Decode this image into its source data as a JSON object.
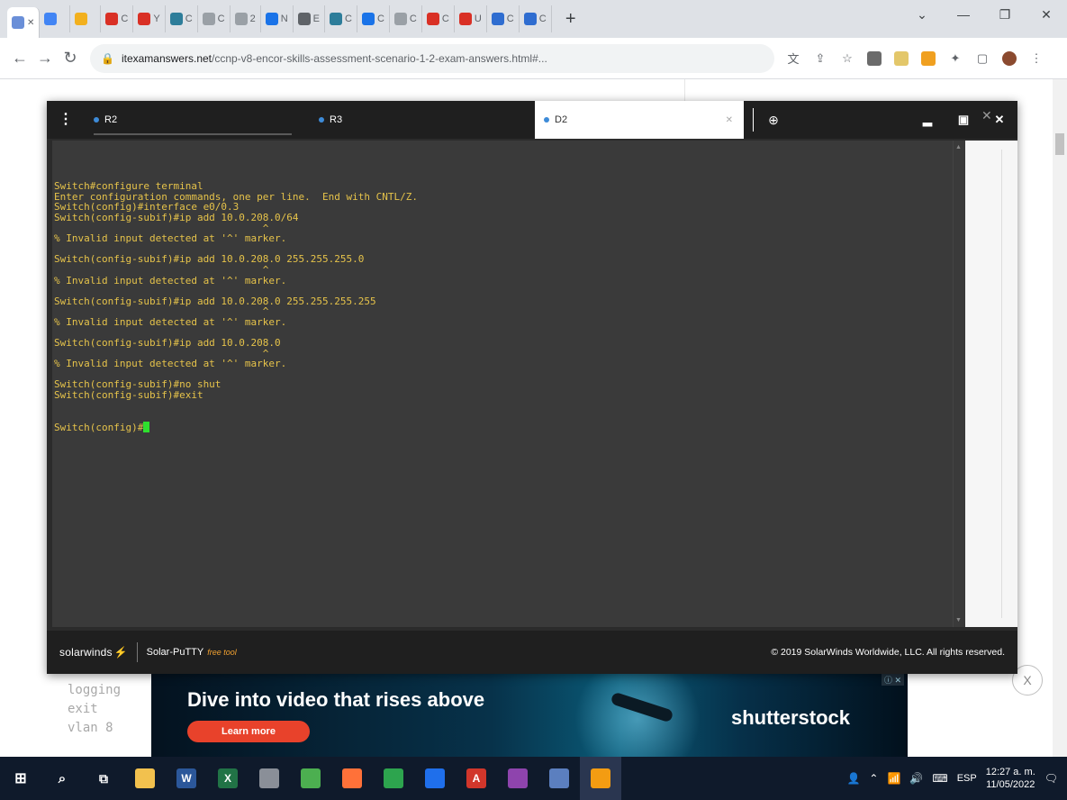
{
  "browser": {
    "tabs": [
      {
        "label": "",
        "color": "#4285f4"
      },
      {
        "label": "",
        "color": "#f2b01e"
      },
      {
        "label": "C",
        "color": "#d93025"
      },
      {
        "label": "Y",
        "color": "#d93025"
      },
      {
        "label": "C",
        "color": "#2d7d9a"
      },
      {
        "label": "C",
        "color": "#9aa0a6"
      },
      {
        "label": "2",
        "color": "#9aa0a6"
      },
      {
        "label": "N",
        "color": "#1a73e8"
      },
      {
        "label": "E",
        "color": "#5f6368"
      },
      {
        "label": "C",
        "color": "#2d7d9a"
      },
      {
        "label": "C",
        "color": "#1a73e8"
      },
      {
        "label": "C",
        "color": "#9aa0a6"
      },
      {
        "label": "C",
        "color": "#d93025"
      },
      {
        "label": "U",
        "color": "#d93025"
      },
      {
        "label": "C",
        "color": "#2f6dd0"
      },
      {
        "label": "C",
        "color": "#2f6dd0"
      }
    ],
    "url_host": "itexamanswers.net",
    "url_path": "/ccnp-v8-encor-skills-assessment-scenario-1-2-exam-answers.html#..."
  },
  "putty": {
    "tabs": [
      {
        "label": "R2"
      },
      {
        "label": "R3"
      },
      {
        "label": "D2"
      }
    ],
    "terminal_lines": [
      "Switch#configure terminal",
      "Enter configuration commands, one per line.  End with CNTL/Z.",
      "Switch(config)#interface e0/0.3",
      "Switch(config-subif)#ip add 10.0.208.0/64",
      "                                   ^",
      "% Invalid input detected at '^' marker.",
      "",
      "Switch(config-subif)#ip add 10.0.208.0 255.255.255.0",
      "                                   ^",
      "% Invalid input detected at '^' marker.",
      "",
      "Switch(config-subif)#ip add 10.0.208.0 255.255.255.255",
      "                                   ^",
      "% Invalid input detected at '^' marker.",
      "",
      "Switch(config-subif)#ip add 10.0.208.0",
      "                                   ^",
      "% Invalid input detected at '^' marker.",
      "",
      "Switch(config-subif)#no shut",
      "Switch(config-subif)#exit"
    ],
    "prompt": "Switch(config)#",
    "footer": {
      "brand": "solarwinds",
      "product": "Solar-PuTTY",
      "free_tag": "free tool",
      "copyright": "© 2019 SolarWinds Worldwide, LLC. All rights reserved."
    }
  },
  "page": {
    "code_lines": [
      "logging",
      "exit",
      "vlan 8"
    ]
  },
  "ad": {
    "headline": "Dive into video that rises above",
    "cta": "Learn more",
    "brand": "shutterstock",
    "close_label": "X"
  },
  "taskbar": {
    "apps": [
      {
        "name": "file-explorer-icon",
        "color": "#f2c14e",
        "glyph": ""
      },
      {
        "name": "word-icon",
        "color": "#2b579a",
        "glyph": "W"
      },
      {
        "name": "excel-icon",
        "color": "#217346",
        "glyph": "X"
      },
      {
        "name": "cisco-icon",
        "color": "#8a8f98",
        "glyph": ""
      },
      {
        "name": "chrome-icon",
        "color": "#4caf50",
        "glyph": ""
      },
      {
        "name": "firefox-icon",
        "color": "#ff7139",
        "glyph": ""
      },
      {
        "name": "vm-icon",
        "color": "#2da44e",
        "glyph": ""
      },
      {
        "name": "packet-tracer-icon",
        "color": "#1f6feb",
        "glyph": ""
      },
      {
        "name": "acrobat-icon",
        "color": "#d1362b",
        "glyph": "A"
      },
      {
        "name": "winrar-icon",
        "color": "#8e44ad",
        "glyph": ""
      },
      {
        "name": "app-icon",
        "color": "#5b7fbf",
        "glyph": ""
      },
      {
        "name": "solar-putty-icon",
        "color": "#f39c12",
        "glyph": ""
      }
    ],
    "language": "ESP",
    "time": "12:27 a. m.",
    "date": "11/05/2022"
  }
}
